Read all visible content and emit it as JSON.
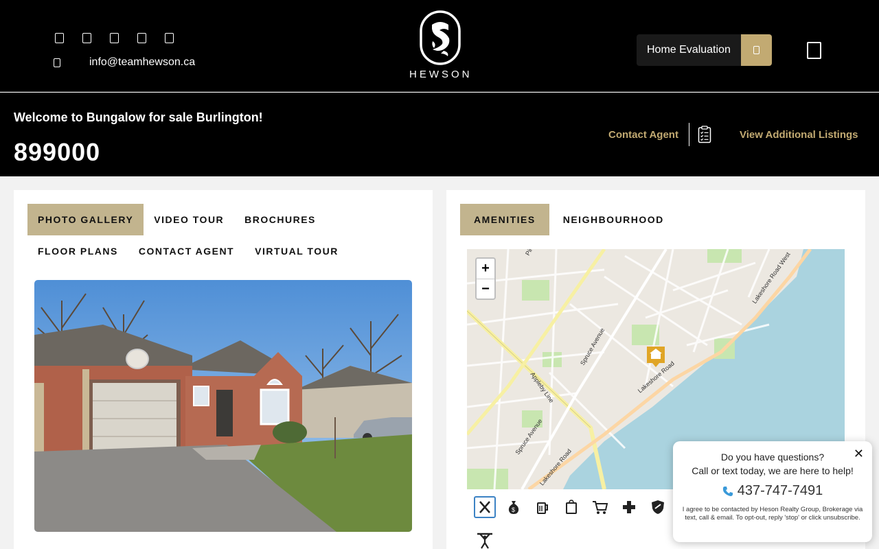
{
  "header": {
    "email": "info@teamhewson.ca",
    "social_icons": [
      "facebook-icon",
      "twitter-icon",
      "instagram-icon",
      "linkedin-icon",
      "youtube-icon"
    ],
    "logo_text": "HEWSON",
    "home_evaluation_label": "Home Evaluation"
  },
  "listing": {
    "welcome": "Welcome to Bungalow for sale Burlington!",
    "price": "899000",
    "contact_agent": "Contact Agent",
    "view_additional": "View Additional Listings"
  },
  "left_tabs": [
    {
      "label": "PHOTO GALLERY",
      "active": true
    },
    {
      "label": "VIDEO TOUR",
      "active": false
    },
    {
      "label": "BROCHURES",
      "active": false
    },
    {
      "label": "FLOOR PLANS",
      "active": false
    },
    {
      "label": "CONTACT AGENT",
      "active": false
    },
    {
      "label": "VIRTUAL TOUR",
      "active": false
    }
  ],
  "right_tabs": [
    {
      "label": "AMENITIES",
      "active": true
    },
    {
      "label": "NEIGHBOURHOOD",
      "active": false
    }
  ],
  "map": {
    "zoom_in": "+",
    "zoom_out": "−",
    "streets": [
      "Pine",
      "Spruce Avenue",
      "Appleby Line",
      "Lakeshore Road",
      "Lakeshore Road West",
      "Spruce Avenue",
      "Lakeshore Road"
    ]
  },
  "amenities": [
    "restaurant-icon",
    "bank-icon",
    "bar-icon",
    "store-icon",
    "grocery-icon",
    "hospital-icon",
    "police-icon",
    "gym-icon"
  ],
  "chat": {
    "close": "✕",
    "line1": "Do you have questions?",
    "line2": "Call or text today, we are here to help!",
    "phone": "437-747-7491",
    "consent": "I agree to be contacted by Heson Realty Group, Brokerage via text, call & email. To opt-out, reply 'stop' or click unsubscribe."
  },
  "colors": {
    "accent": "#c2aa72",
    "tab_active": "#c2b48e",
    "header_bg": "#000000"
  }
}
